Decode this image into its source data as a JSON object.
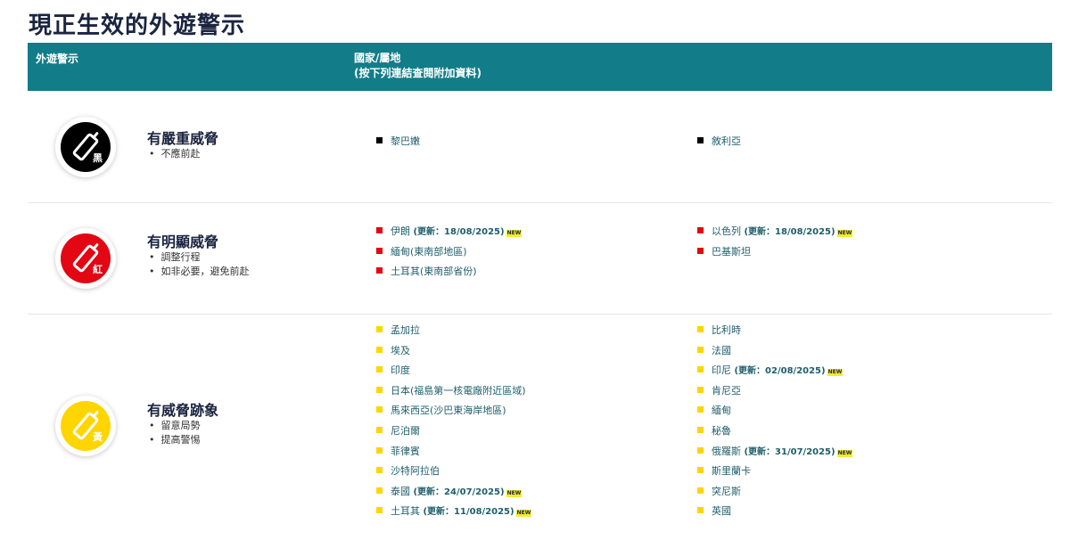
{
  "page_title": "現正生效的外遊警示",
  "table_header": {
    "col1": "外遊警示",
    "col2_line1": "國家/屬地",
    "col2_line2": "(按下列連結查閱附加資料)"
  },
  "new_label": "NEW",
  "levels": [
    {
      "color": "#000000",
      "badge_char": "黑",
      "title": "有嚴重威脅",
      "advice": [
        "不應前赴"
      ],
      "left": [
        {
          "name": "黎巴嫩",
          "update": ""
        }
      ],
      "right": [
        {
          "name": "敘利亞",
          "update": ""
        }
      ]
    },
    {
      "color": "#e30613",
      "badge_char": "紅",
      "title": "有明顯威脅",
      "advice": [
        "調整行程",
        "如非必要，避免前赴"
      ],
      "left": [
        {
          "name": "伊朗",
          "update": " (更新：18/08/2025)"
        },
        {
          "name": "緬甸(東南部地區)",
          "update": ""
        },
        {
          "name": "土耳其(東南部省份)",
          "update": ""
        }
      ],
      "right": [
        {
          "name": "以色列",
          "update": " (更新：18/08/2025)"
        },
        {
          "name": "巴基斯坦",
          "update": ""
        }
      ]
    },
    {
      "color": "#ffd500",
      "badge_char": "黃",
      "title": "有威脅跡象",
      "advice": [
        "留意局勢",
        "提高警惕"
      ],
      "left": [
        {
          "name": "孟加拉",
          "update": ""
        },
        {
          "name": "埃及",
          "update": ""
        },
        {
          "name": "印度",
          "update": ""
        },
        {
          "name": "日本(福島第一核電廠附近區域)",
          "update": ""
        },
        {
          "name": "馬來西亞(沙巴東海岸地區)",
          "update": ""
        },
        {
          "name": "尼泊爾",
          "update": ""
        },
        {
          "name": "菲律賓",
          "update": ""
        },
        {
          "name": "沙特阿拉伯",
          "update": ""
        },
        {
          "name": "泰國",
          "update": " (更新：24/07/2025)"
        },
        {
          "name": "土耳其",
          "update": " (更新：11/08/2025)"
        }
      ],
      "right": [
        {
          "name": "比利時",
          "update": ""
        },
        {
          "name": "法國",
          "update": ""
        },
        {
          "name": "印尼",
          "update": " (更新：02/08/2025)"
        },
        {
          "name": "肯尼亞",
          "update": ""
        },
        {
          "name": "緬甸",
          "update": ""
        },
        {
          "name": "秘魯",
          "update": ""
        },
        {
          "name": "俄羅斯",
          "update": " (更新：31/07/2025)"
        },
        {
          "name": "斯里蘭卡",
          "update": ""
        },
        {
          "name": "突尼斯",
          "update": ""
        },
        {
          "name": "英國",
          "update": ""
        }
      ]
    }
  ]
}
